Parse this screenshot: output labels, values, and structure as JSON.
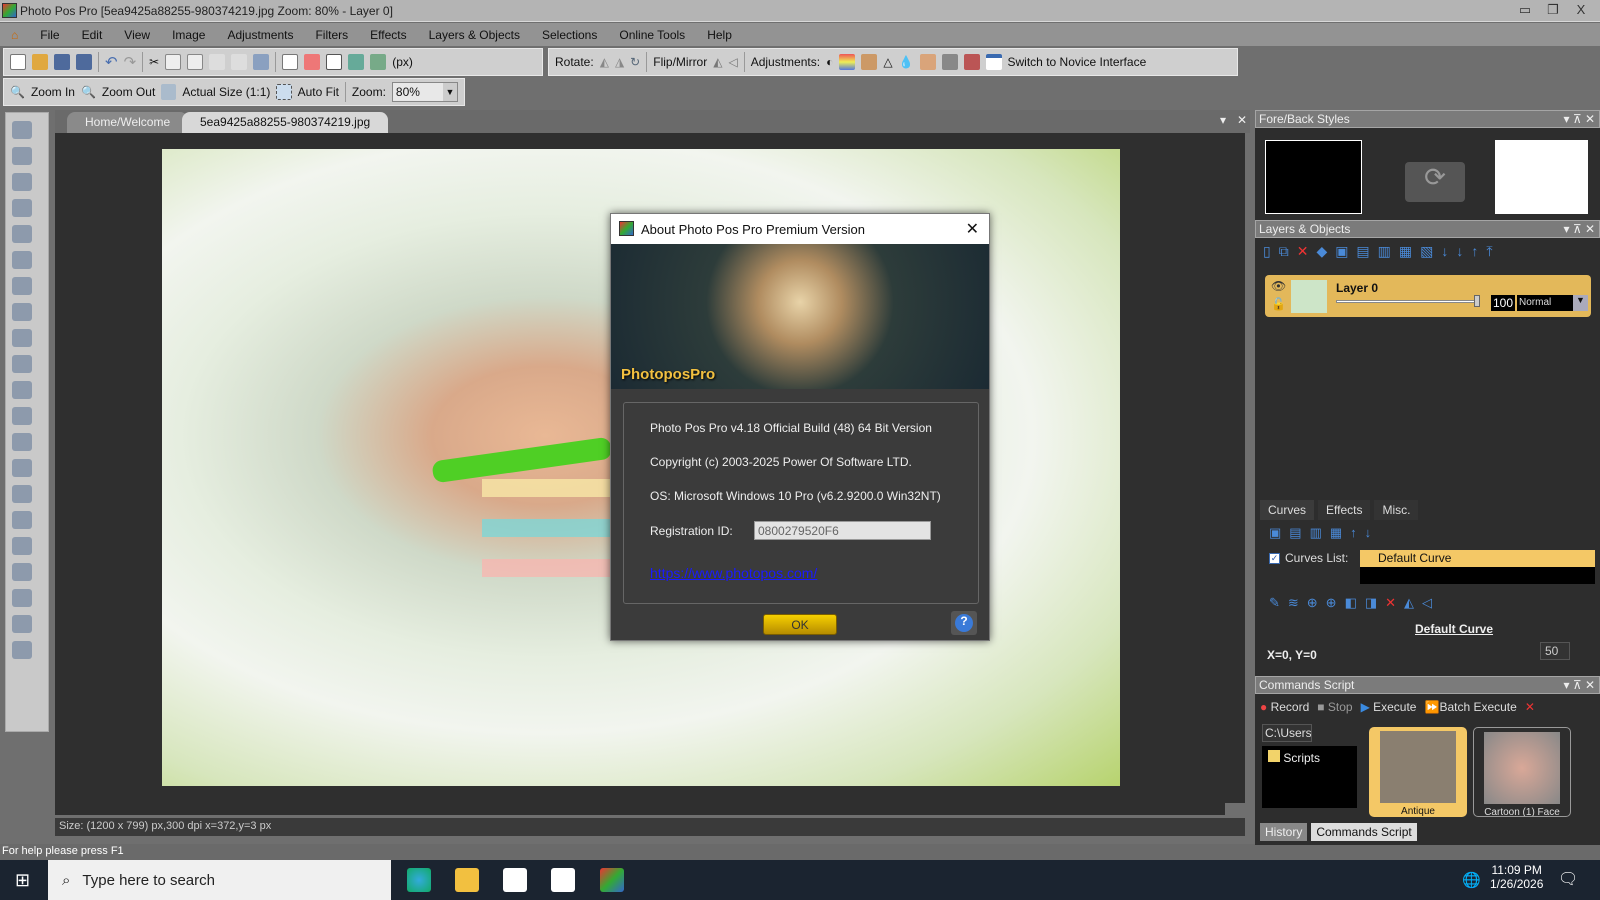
{
  "window": {
    "title": "Photo Pos Pro [5ea9425a88255-980374219.jpg Zoom: 80% - Layer 0]",
    "minimize": "▭",
    "restore": "❐",
    "close": "X"
  },
  "menu": [
    "File",
    "Edit",
    "View",
    "Image",
    "Adjustments",
    "Filters",
    "Effects",
    "Layers & Objects",
    "Selections",
    "Online Tools",
    "Help"
  ],
  "toolbar": {
    "units": "(px)",
    "rotate": "Rotate:",
    "flip": "Flip/Mirror",
    "adjustments": "Adjustments:",
    "novice": "Switch to Novice Interface"
  },
  "zoombar": {
    "zoom_in": "Zoom In",
    "zoom_out": "Zoom Out",
    "actual_size": "Actual Size (1:1)",
    "auto_fit": "Auto Fit",
    "zoom_label": "Zoom:",
    "zoom_value": "80%"
  },
  "tabs": [
    "Home/Welcome",
    "5ea9425a88255-980374219.jpg"
  ],
  "status": "Size: (1200 x 799) px,300 dpi   x=372,y=3 px",
  "help": "For help please press F1",
  "dialog": {
    "title": "About Photo Pos Pro Premium Version",
    "logo": "PhotoposPro",
    "version": "Photo Pos Pro v4.18 Official Build (48) 64 Bit Version",
    "copyright": "Copyright (c) 2003-2025 Power Of Software LTD.",
    "os": "OS: Microsoft Windows 10 Pro (v6.2.9200.0 Win32NT)",
    "reg_label": "Registration ID:",
    "reg_id": "0800279520F6",
    "link": "https://www.photopos.com/",
    "ok": "OK",
    "help": "?"
  },
  "panels": {
    "foreback": {
      "title": "Fore/Back Styles"
    },
    "layers": {
      "title": "Layers & Objects",
      "layer_name": "Layer 0",
      "opacity": "100",
      "blend": "Normal",
      "opacity_pct": 100
    },
    "curves": {
      "tabs": [
        "Curves",
        "Effects",
        "Misc."
      ],
      "list_label": "Curves List:",
      "item": "Default Curve",
      "curve_name": "Default Curve",
      "coords": "X=0, Y=0",
      "value": "50"
    },
    "commands": {
      "title": "Commands Script",
      "record": "Record",
      "stop": "Stop",
      "execute": "Execute",
      "batch": "Batch Execute",
      "path": "C:\\Users\\",
      "folder": "Scripts",
      "thumbs": [
        "Antique",
        "Cartoon (1) Face"
      ],
      "bottom_tabs": [
        "History",
        "Commands Script"
      ]
    }
  },
  "taskbar": {
    "search": "Type here to search",
    "time": "11:09 PM",
    "date": "1/26/2026"
  }
}
